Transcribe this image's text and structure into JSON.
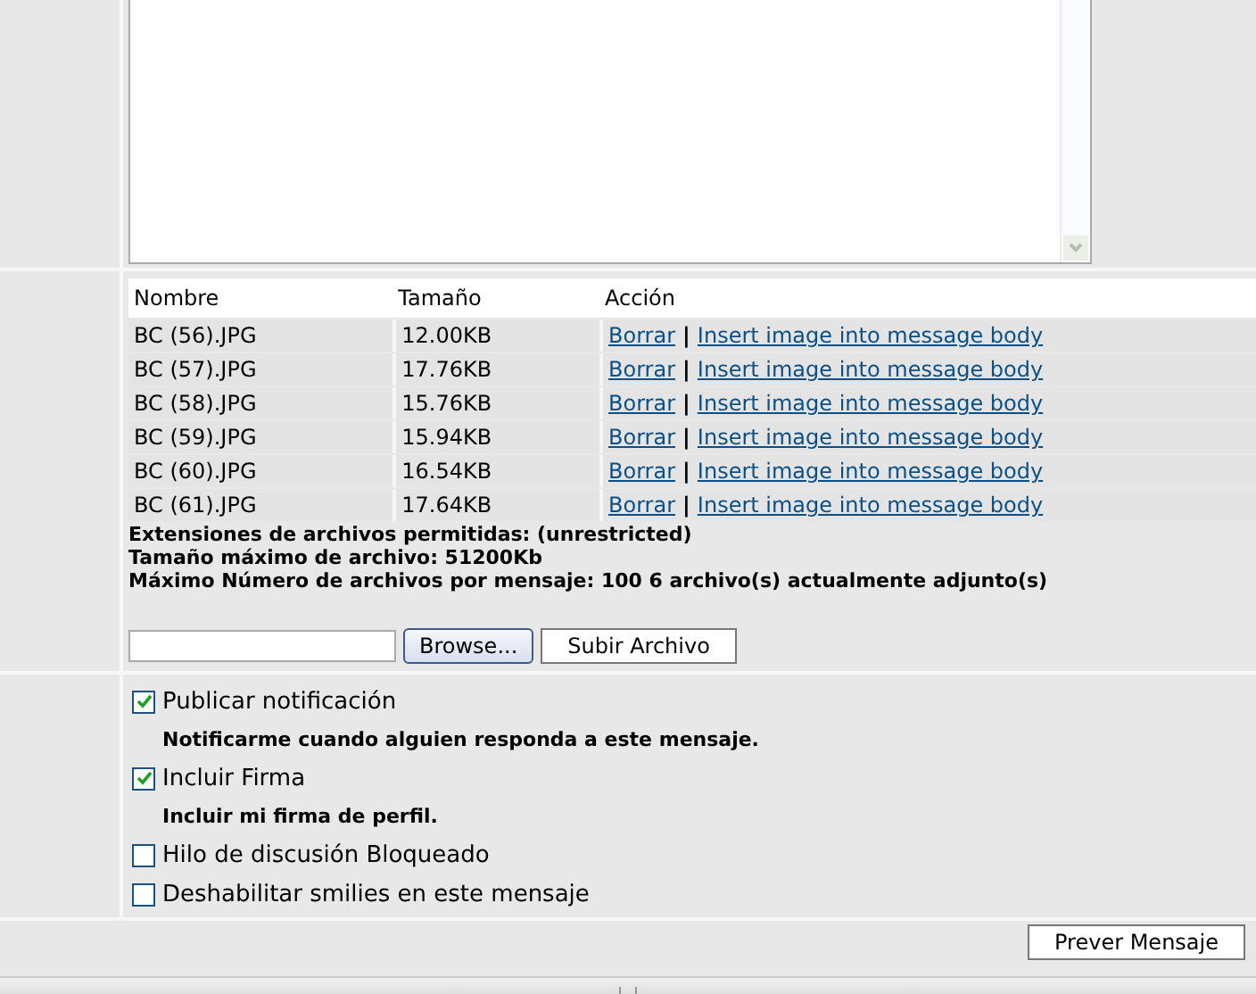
{
  "attachments": {
    "columns": [
      "Nombre",
      "Tamaño",
      "Acción"
    ],
    "rows": [
      {
        "name": "BC (56).JPG",
        "size": "12.00KB",
        "delete": "Borrar",
        "separator": "|",
        "insert": "Insert image into message body"
      },
      {
        "name": "BC (57).JPG",
        "size": "17.76KB",
        "delete": "Borrar",
        "separator": "|",
        "insert": "Insert image into message body"
      },
      {
        "name": "BC (58).JPG",
        "size": "15.76KB",
        "delete": "Borrar",
        "separator": "|",
        "insert": "Insert image into message body"
      },
      {
        "name": "BC (59).JPG",
        "size": "15.94KB",
        "delete": "Borrar",
        "separator": "|",
        "insert": "Insert image into message body"
      },
      {
        "name": "BC (60).JPG",
        "size": "16.54KB",
        "delete": "Borrar",
        "separator": "|",
        "insert": "Insert image into message body"
      },
      {
        "name": "BC (61).JPG",
        "size": "17.64KB",
        "delete": "Borrar",
        "separator": "|",
        "insert": "Insert image into message body"
      }
    ],
    "info": [
      "Extensiones de archivos permitidas: (unrestricted)",
      "Tamaño máximo de archivo: 51200Kb",
      "Máximo Número de archivos por mensaje: 100 6 archivo(s) actualmente adjunto(s)"
    ]
  },
  "upload": {
    "browse_button": "Browse...",
    "submit_button": "Subir Archivo"
  },
  "options": [
    {
      "kind": "checkbox",
      "label": "Publicar notificación",
      "checked": true
    },
    {
      "kind": "note",
      "label": "Notificarme cuando alguien responda a este mensaje."
    },
    {
      "kind": "checkbox",
      "label": "Incluir Firma",
      "checked": true
    },
    {
      "kind": "note",
      "label": "Incluir mi firma de perfil."
    },
    {
      "kind": "checkbox",
      "label": "Hilo de discusión Bloqueado",
      "checked": false
    },
    {
      "kind": "checkbox",
      "label": "Deshabilitar smilies en este mensaje",
      "checked": false
    }
  ],
  "footer": {
    "preview_button": "Prever Mensaje"
  }
}
